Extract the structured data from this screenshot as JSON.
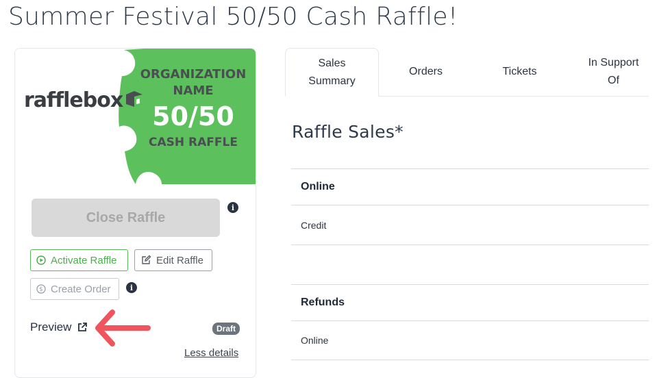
{
  "page": {
    "title": "Summer Festival 50/50 Cash Raffle!"
  },
  "raffle_card": {
    "logo_text": "rafflebox",
    "banner": {
      "org_line1": "ORGANIZATION",
      "org_line2": "NAME",
      "big": "50/50",
      "cash": "CASH RAFFLE",
      "color": "#5cc15d"
    },
    "close_button": "Close Raffle",
    "activate_button": "Activate Raffle",
    "edit_button": "Edit Raffle",
    "create_order_button": "Create Order",
    "preview_link": "Preview",
    "status_badge": "Draft",
    "less_details_link": "Less details"
  },
  "tabs": [
    {
      "label": "Sales Summary",
      "active": true
    },
    {
      "label": "Orders",
      "active": false
    },
    {
      "label": "Tickets",
      "active": false
    },
    {
      "label": "In Support Of",
      "active": false
    }
  ],
  "sales": {
    "title": "Raffle Sales*",
    "rows": [
      {
        "label": "Online",
        "type": "header"
      },
      {
        "label": "Credit",
        "type": "item"
      },
      {
        "label": "",
        "type": "item"
      },
      {
        "label": "Refunds",
        "type": "header"
      },
      {
        "label": "Online",
        "type": "item"
      }
    ]
  },
  "colors": {
    "accent_green": "#5cb85c",
    "annotation_arrow": "#f0545c"
  }
}
